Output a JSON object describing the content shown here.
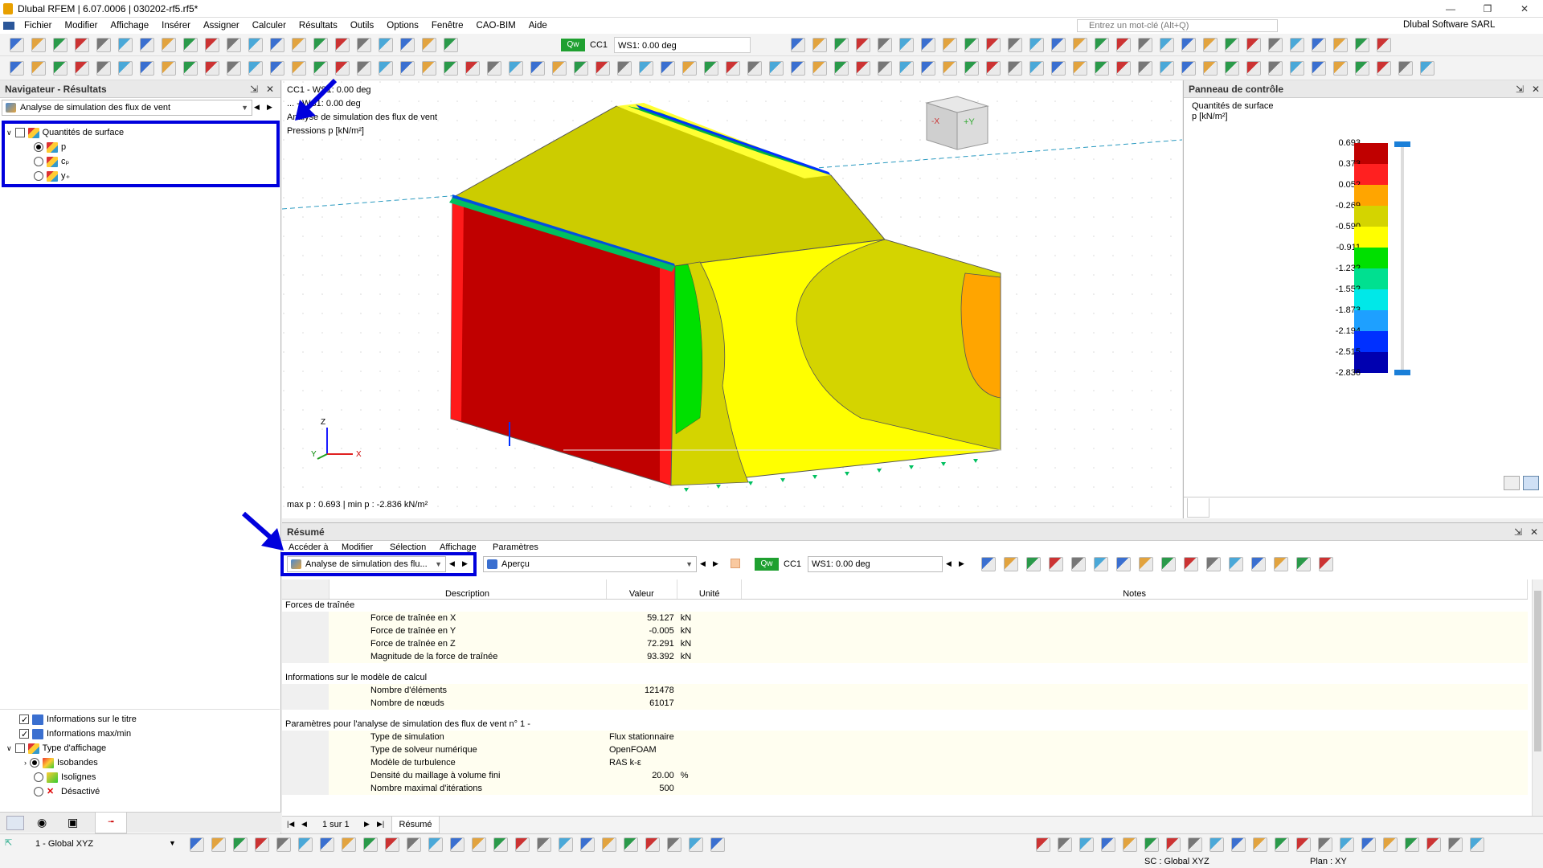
{
  "window": {
    "title": "Dlubal RFEM | 6.07.0006 | 030202-rf5.rf5*",
    "controls": [
      "—",
      "❐",
      "✕"
    ]
  },
  "menu": {
    "items": [
      "Fichier",
      "Modifier",
      "Affichage",
      "Insérer",
      "Assigner",
      "Calculer",
      "Résultats",
      "Outils",
      "Options",
      "Fenêtre",
      "CAO-BIM",
      "Aide"
    ],
    "search_placeholder": "Entrez un mot-clé (Alt+Q)",
    "company": "Dlubal Software SARL"
  },
  "toolbar": {
    "load_badge": "Qw",
    "load_case": "CC1",
    "load_combo_value": "WS1: 0.00 deg"
  },
  "navigator": {
    "title": "Navigateur - Résultats",
    "combo_value": "Analyse de simulation des flux de vent",
    "tree": {
      "root_label": "Quantités de surface",
      "options": [
        {
          "label": "p",
          "selected": true
        },
        {
          "label": "cₚ",
          "selected": false
        },
        {
          "label": "y₊",
          "selected": false
        }
      ]
    },
    "bottom": {
      "title_info": "Informations sur le titre",
      "maxmin_info": "Informations max/min",
      "display_type": "Type d'affichage",
      "types": [
        {
          "label": "Isobandes",
          "selected": true
        },
        {
          "label": "Isolignes",
          "selected": false
        },
        {
          "label": "Désactivé",
          "selected": false
        }
      ]
    }
  },
  "viewport": {
    "info_lines": [
      "CC1 - WS1: 0.00 deg",
      "... - WS1: 0.00 deg",
      "Analyse de simulation des flux de vent",
      "Pressions p [kN/m²]"
    ],
    "maxmin": "max p : 0.693 | min p : -2.836 kN/m²",
    "axis_x": "X",
    "axis_y": "Y",
    "axis_z": "Z",
    "cube_label_y": "+Y",
    "cube_label_x": "-X"
  },
  "control_panel": {
    "title": "Panneau de contrôle",
    "subtitle": "Quantités de surface",
    "unit": "p [kN/m²]",
    "legend": [
      {
        "value": "0.693",
        "color": "#c00000"
      },
      {
        "value": "0.373",
        "color": "#ff2020"
      },
      {
        "value": "0.052",
        "color": "#ffa500"
      },
      {
        "value": "-0.269",
        "color": "#d4d400"
      },
      {
        "value": "-0.590",
        "color": "#ffff00"
      },
      {
        "value": "-0.911",
        "color": "#00e000"
      },
      {
        "value": "-1.232",
        "color": "#00e090"
      },
      {
        "value": "-1.552",
        "color": "#00e8e8"
      },
      {
        "value": "-1.873",
        "color": "#1ea0ff"
      },
      {
        "value": "-2.194",
        "color": "#0030ff"
      },
      {
        "value": "-2.515",
        "color": "#0000b0"
      },
      {
        "value": "-2.836",
        "color": null
      }
    ]
  },
  "summary": {
    "title": "Résumé",
    "menu": [
      "Accéder à",
      "Modifier",
      "Sélection",
      "Affichage",
      "Paramètres"
    ],
    "analysis_combo": "Analyse de simulation des flu...",
    "view_combo": "Aperçu",
    "load_badge": "Qw",
    "load_case": "CC1",
    "load_combo": "WS1: 0.00 deg",
    "columns": [
      "Description",
      "Valeur",
      "Unité",
      "Notes"
    ],
    "groups": [
      {
        "title": "Forces de traînée",
        "rows": [
          {
            "desc": "Force de traînée en X",
            "value": "59.127",
            "unit": "kN"
          },
          {
            "desc": "Force de traînée en Y",
            "value": "-0.005",
            "unit": "kN"
          },
          {
            "desc": "Force de traînée en Z",
            "value": "72.291",
            "unit": "kN"
          },
          {
            "desc": "Magnitude de la force de traînée",
            "value": "93.392",
            "unit": "kN"
          }
        ]
      },
      {
        "title": "Informations sur le modèle de calcul",
        "rows": [
          {
            "desc": "Nombre d'éléments",
            "value": "121478",
            "unit": ""
          },
          {
            "desc": "Nombre de nœuds",
            "value": "61017",
            "unit": ""
          }
        ]
      },
      {
        "title": "Paramètres pour l'analyse de simulation des flux de vent n° 1 -",
        "rows": [
          {
            "desc": "Type de simulation",
            "value": "Flux stationnaire",
            "unit": "",
            "left": true
          },
          {
            "desc": "Type de solveur numérique",
            "value": "OpenFOAM",
            "unit": "",
            "left": true
          },
          {
            "desc": "Modèle de turbulence",
            "value": "RAS k-ε",
            "unit": "",
            "left": true
          },
          {
            "desc": "Densité du maillage à volume fini",
            "value": "20.00",
            "unit": "%"
          },
          {
            "desc": "Nombre maximal d'itérations",
            "value": "500",
            "unit": ""
          }
        ]
      }
    ],
    "pager": "1 sur 1",
    "tab": "Résumé"
  },
  "status": {
    "coord_system": "1 - Global XYZ",
    "sc": "SC : Global XYZ",
    "plan": "Plan : XY"
  },
  "colors": {
    "accent_blue": "#0000dd",
    "title_bg": "#ffffff"
  }
}
